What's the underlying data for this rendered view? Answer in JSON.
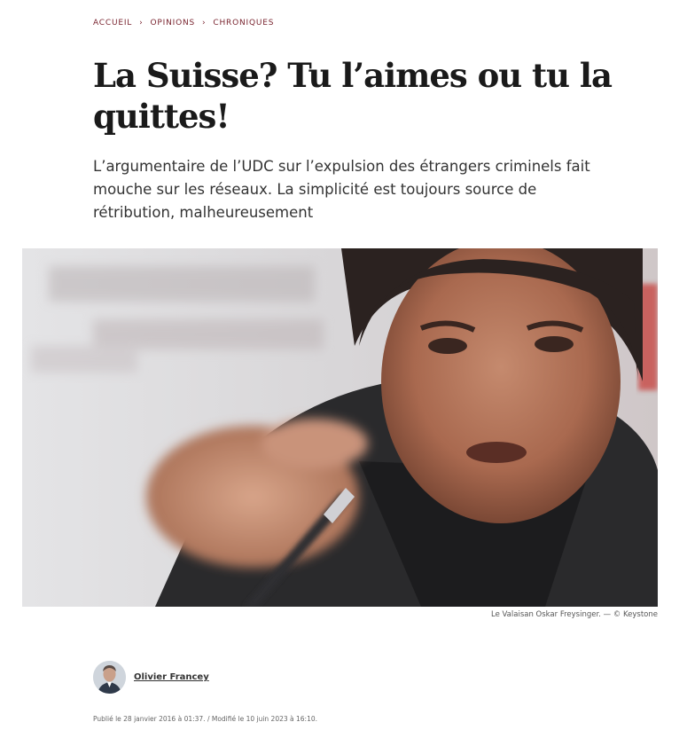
{
  "breadcrumb": {
    "items": [
      "ACCUEIL",
      "OPINIONS",
      "CHRONIQUES"
    ],
    "separator": "›"
  },
  "article": {
    "title": "La Suisse? Tu l’aimes ou tu la quittes!",
    "lede": "L’argumentaire de l’UDC sur l’expulsion des étrangers criminels fait mouche sur les réseaux. La simplicité est toujours source de rétribution, malheureusement",
    "image_caption": "Le Valaisan Oskar Freysinger. — © Keystone",
    "author": "Olivier Francey",
    "dates": "Publié le 28 janvier 2016 à 01:37. / Modifié le 10 juin 2023 à 16:10."
  },
  "colors": {
    "breadcrumb": "#7a2530",
    "title": "#1a1a1a",
    "text": "#333333"
  }
}
